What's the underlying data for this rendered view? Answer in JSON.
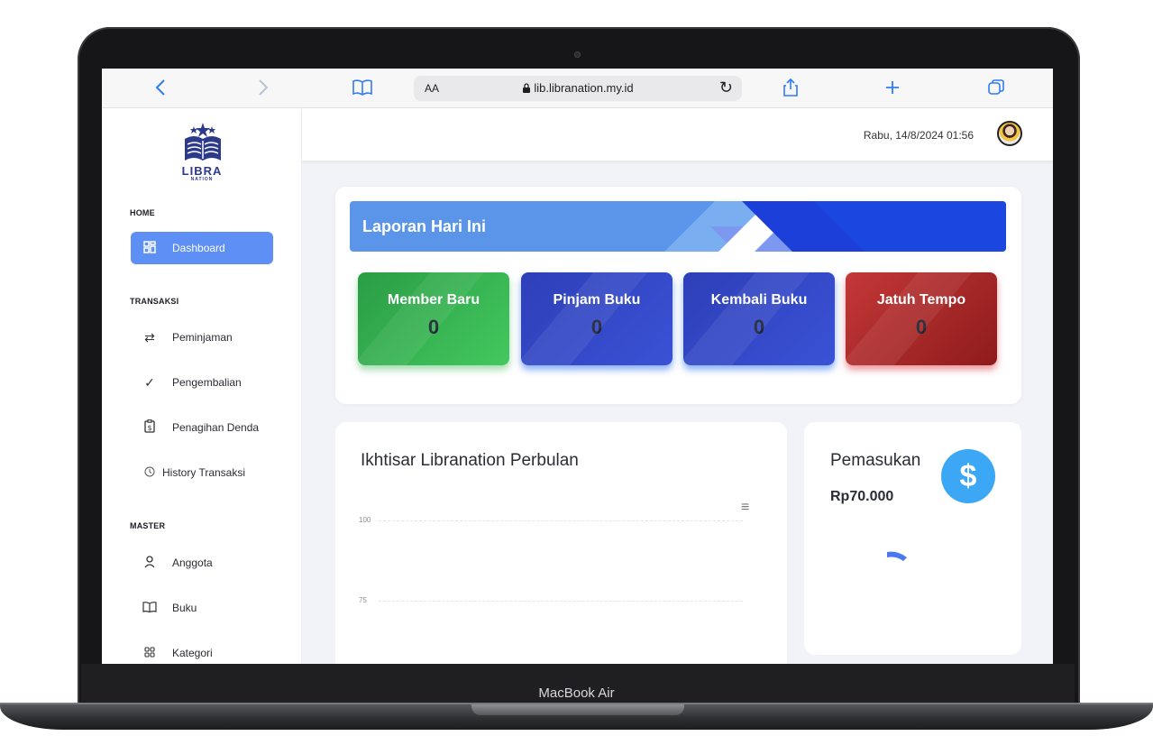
{
  "device": {
    "label": "MacBook Air"
  },
  "browser": {
    "text_size_label": "AA",
    "url": "lib.libranation.my.id"
  },
  "sidebar": {
    "logo_text": "LIBRA",
    "logo_sub": "NATION",
    "sections": [
      {
        "label": "HOME"
      },
      {
        "label": "TRANSAKSI"
      },
      {
        "label": "MASTER"
      }
    ],
    "items": [
      {
        "label": "Dashboard",
        "icon": "dashboard-icon",
        "active": true
      },
      {
        "label": "Peminjaman",
        "icon": "swap-arrows-icon"
      },
      {
        "label": "Pengembalian",
        "icon": "check-icon"
      },
      {
        "label": "Penagihan Denda",
        "icon": "invoice-dollar-icon"
      },
      {
        "label": "History Transaksi",
        "icon": "clock-icon"
      },
      {
        "label": "Anggota",
        "icon": "user-icon"
      },
      {
        "label": "Buku",
        "icon": "book-icon"
      },
      {
        "label": "Kategori",
        "icon": "grid-icon"
      }
    ]
  },
  "header": {
    "datetime": "Rabu, 14/8/2024 01:56"
  },
  "report": {
    "title": "Laporan Hari Ini",
    "stats": [
      {
        "label": "Member Baru",
        "value": "0",
        "color": "#2ea84a"
      },
      {
        "label": "Pinjam Buku",
        "value": "0",
        "color": "#3447c6"
      },
      {
        "label": "Kembali Buku",
        "value": "0",
        "color": "#3447c6"
      },
      {
        "label": "Jatuh Tempo",
        "value": "0",
        "color": "#b32b2b"
      }
    ]
  },
  "chart_data": {
    "type": "line",
    "title": "Ikhtisar Libranation Perbulan",
    "y_ticks": [
      "100",
      "75"
    ],
    "series": []
  },
  "income": {
    "title": "Pemasukan",
    "value": "Rp70.000"
  },
  "colors": {
    "accent": "#5d8ff4",
    "header_blue": "#1b47e0",
    "dollar_badge": "#3ba7f5"
  }
}
